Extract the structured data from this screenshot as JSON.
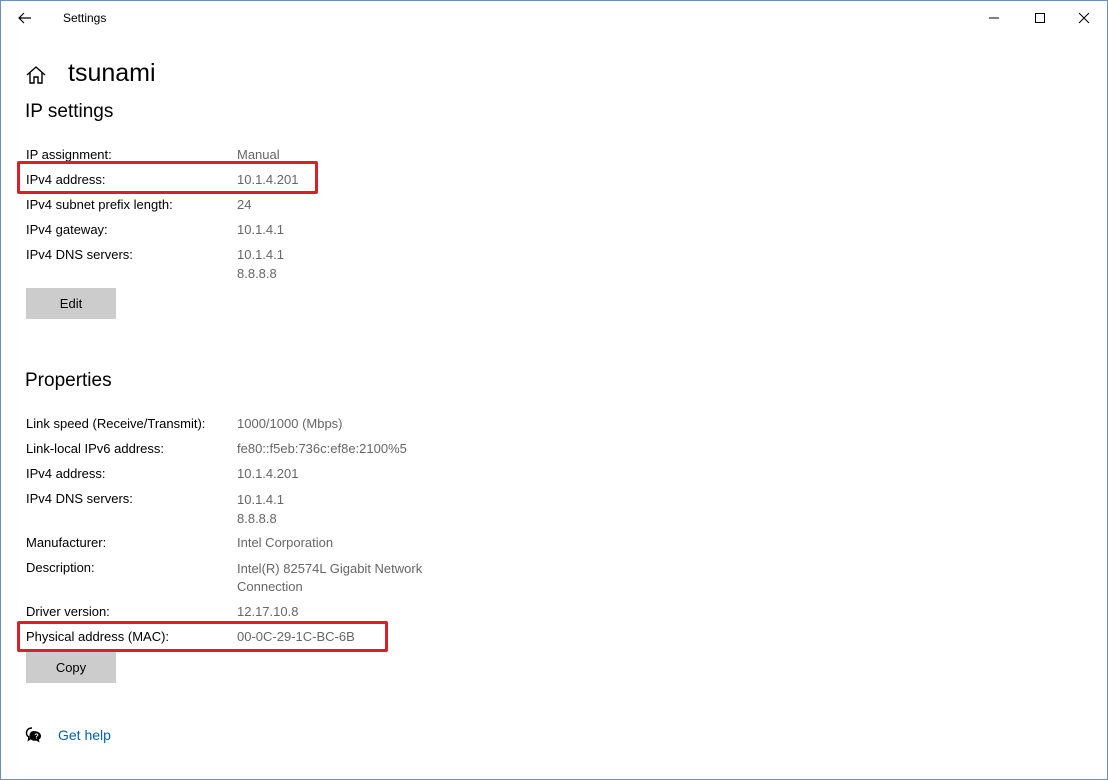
{
  "window": {
    "title": "Settings"
  },
  "header": {
    "title": "tsunami"
  },
  "ip_settings": {
    "title": "IP settings",
    "rows": [
      {
        "label": "IP assignment:",
        "value": "Manual"
      },
      {
        "label": "IPv4 address:",
        "value": "10.1.4.201"
      },
      {
        "label": "IPv4 subnet prefix length:",
        "value": "24"
      },
      {
        "label": "IPv4 gateway:",
        "value": "10.1.4.1"
      },
      {
        "label": "IPv4 DNS servers:",
        "value": "10.1.4.1",
        "value2": "8.8.8.8"
      }
    ],
    "edit_label": "Edit"
  },
  "properties": {
    "title": "Properties",
    "rows": [
      {
        "label": "Link speed (Receive/Transmit):",
        "value": "1000/1000 (Mbps)"
      },
      {
        "label": "Link-local IPv6 address:",
        "value": "fe80::f5eb:736c:ef8e:2100%5"
      },
      {
        "label": "IPv4 address:",
        "value": "10.1.4.201"
      },
      {
        "label": "IPv4 DNS servers:",
        "value": "10.1.4.1",
        "value2": "8.8.8.8"
      },
      {
        "label": "Manufacturer:",
        "value": "Intel Corporation"
      },
      {
        "label": "Description:",
        "value": "Intel(R) 82574L Gigabit Network",
        "value2": "Connection"
      },
      {
        "label": "Driver version:",
        "value": "12.17.10.8"
      },
      {
        "label": "Physical address (MAC):",
        "value": "00-0C-29-1C-BC-6B"
      }
    ],
    "copy_label": "Copy"
  },
  "help": {
    "label": "Get help"
  },
  "colors": {
    "accent": "#0063b1",
    "highlight": "#d9202a",
    "button_bg": "#cccccc"
  },
  "icons": [
    "back-arrow-icon",
    "minimize-icon",
    "maximize-icon",
    "close-icon",
    "home-icon",
    "help-chat-icon"
  ]
}
